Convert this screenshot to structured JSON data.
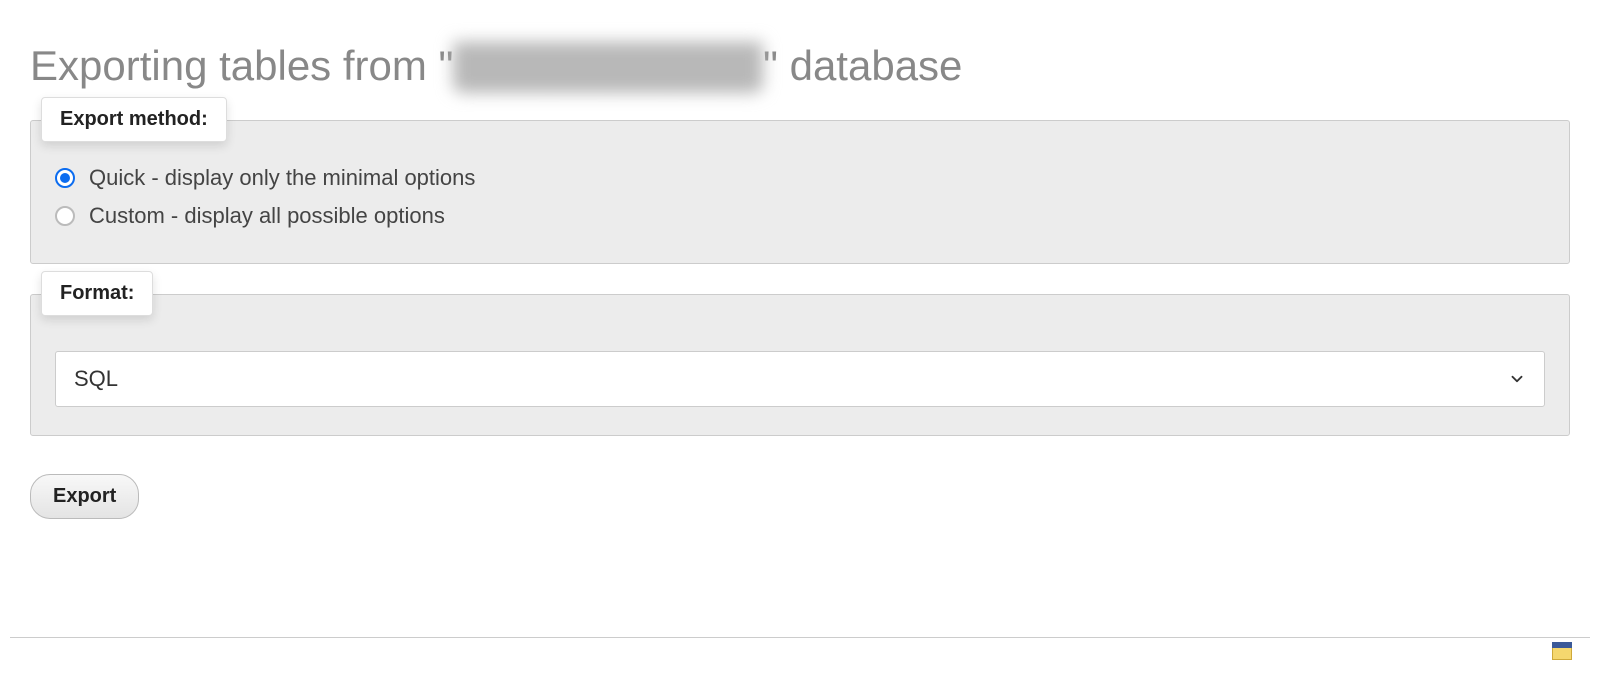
{
  "title": {
    "prefix": "Exporting tables from \"",
    "blurred_db_name": "██████████",
    "suffix": "\" database"
  },
  "export_method": {
    "legend": "Export method:",
    "options": [
      {
        "label": "Quick - display only the minimal options",
        "checked": true
      },
      {
        "label": "Custom - display all possible options",
        "checked": false
      }
    ]
  },
  "format": {
    "legend": "Format:",
    "selected": "SQL"
  },
  "actions": {
    "export_label": "Export"
  }
}
